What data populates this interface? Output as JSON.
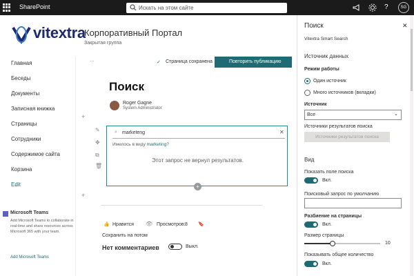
{
  "topbar": {
    "app_name": "SharePoint",
    "search_placeholder": "Искать на этом сайте",
    "avatar_initials": "SG"
  },
  "header": {
    "logo_text": "vitextra",
    "site_title": "Корпоративный Портал",
    "site_subtitle": "Закрытая группа"
  },
  "nav": {
    "items": [
      "Главная",
      "Беседы",
      "Документы",
      "Записная книжка",
      "Страницы",
      "Сотрудники",
      "Содержимое сайта",
      "Корзина"
    ],
    "edit": "Edit"
  },
  "teams": {
    "title": "Microsoft Teams",
    "text": "Add Microsoft Teams to collaborate in real-time and share resources across Microsoft 365 with your team.",
    "link": "Add Microsoft Teams"
  },
  "cmdbar": {
    "ellipsis": "...",
    "saved": "Страница сохранена",
    "republish": "Повторить публикацию"
  },
  "page": {
    "title": "Поиск",
    "author_name": "Roger Gagne",
    "author_role": "System Administrator"
  },
  "webpart": {
    "query": "marketeng",
    "did_you_mean": "Имелось в виду",
    "suggestion": "marketing",
    "no_results": "Этот запрос не вернул результатов."
  },
  "footer": {
    "like": "Нравится",
    "views_label": "Просмотров:",
    "views": "8",
    "save": "Сохранить на потом",
    "comments_title": "Нет комментариев",
    "toggle_off": "Выкл."
  },
  "panel": {
    "title": "Поиск",
    "subtitle": "Vitextra Smart Search",
    "source_heading": "Источник данных",
    "mode_label": "Режим работы",
    "mode_single": "Один источник",
    "mode_multi": "Много источников (вкладки)",
    "source_label": "Источник",
    "source_value": "Все",
    "results_source_label": "Источники результатов поиска",
    "results_source_button": "Источники результатов поиска",
    "view_heading": "Вид",
    "show_search_label": "Показать поле поиска",
    "on": "Вкл.",
    "default_query_label": "Поисковый запрос по умолчанию",
    "paging_label": "Разбиение на страницы",
    "page_size_label": "Размер страницы",
    "page_size_value": "10",
    "show_total_label": "Показывать общее количество"
  },
  "colors": {
    "accent": "#1e6b73",
    "topbar": "#1b1b1b",
    "logo": "#1e2a6e"
  }
}
